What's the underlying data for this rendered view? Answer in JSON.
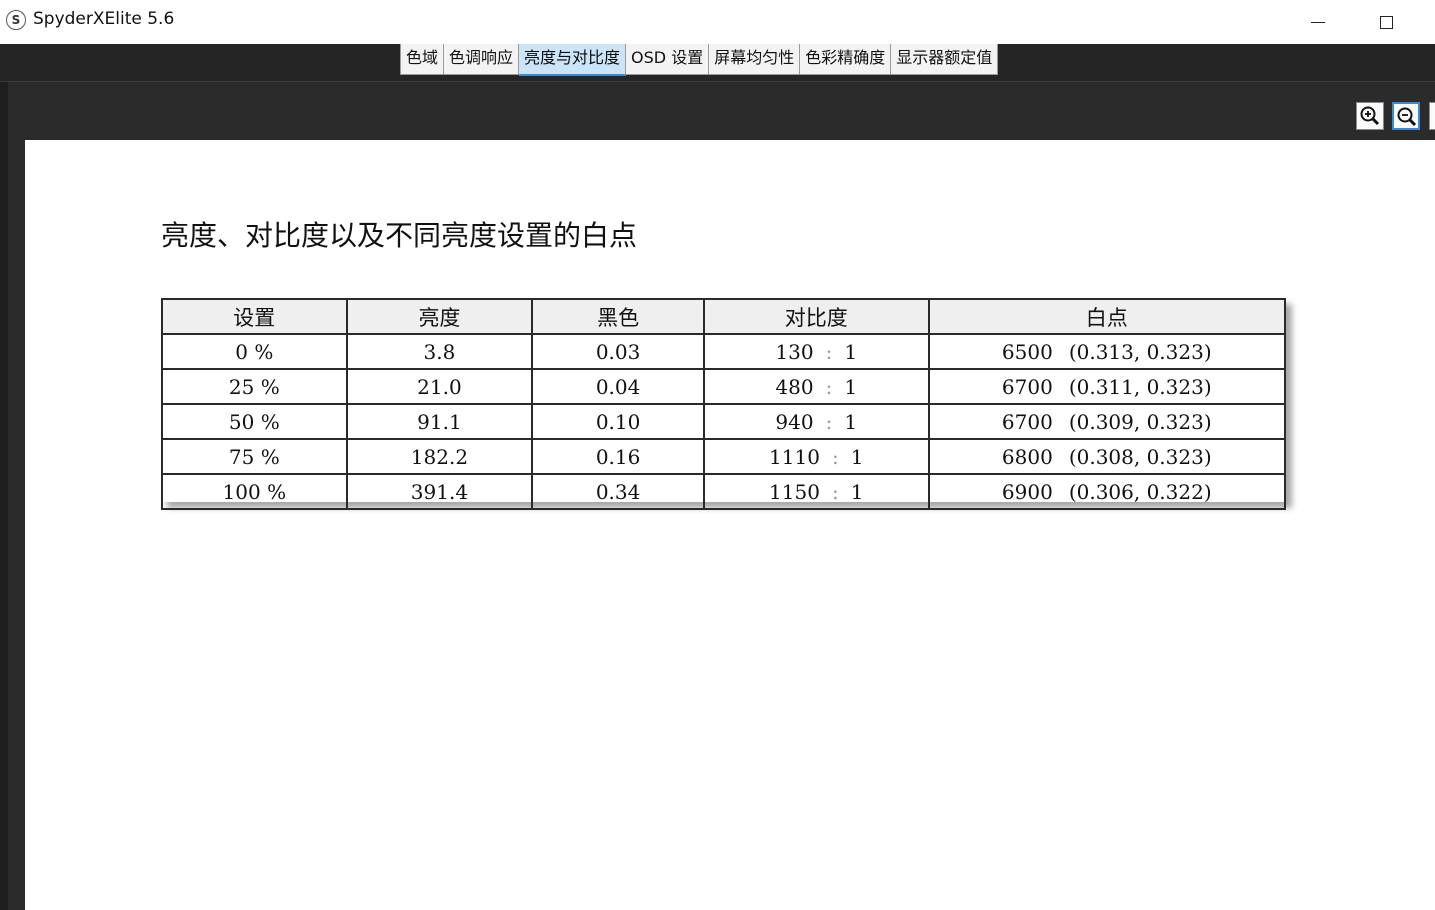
{
  "window": {
    "app_icon_letter": "S",
    "title": "SpyderXElite 5.6"
  },
  "tabs": [
    {
      "label": "色域",
      "active": false
    },
    {
      "label": "色调响应",
      "active": false
    },
    {
      "label": "亮度与对比度",
      "active": true
    },
    {
      "label": "OSD 设置",
      "active": false
    },
    {
      "label": "屏幕均匀性",
      "active": false
    },
    {
      "label": "色彩精确度",
      "active": false
    },
    {
      "label": "显示器额定值",
      "active": false
    }
  ],
  "toolbar": {
    "zoom_in_icon": "zoom-in-icon",
    "zoom_out_icon": "zoom-out-icon"
  },
  "report": {
    "title": "亮度、对比度以及不同亮度设置的白点",
    "columns": [
      "设置",
      "亮度",
      "黑色",
      "对比度",
      "白点"
    ],
    "rows": [
      {
        "setting": "0 %",
        "luminance": "3.8",
        "black": "0.03",
        "contrast": "130",
        "ratio": "1",
        "cct": "6500",
        "xy": "(0.313, 0.323)"
      },
      {
        "setting": "25 %",
        "luminance": "21.0",
        "black": "0.04",
        "contrast": "480",
        "ratio": "1",
        "cct": "6700",
        "xy": "(0.311, 0.323)"
      },
      {
        "setting": "50 %",
        "luminance": "91.1",
        "black": "0.10",
        "contrast": "940",
        "ratio": "1",
        "cct": "6700",
        "xy": "(0.309, 0.323)"
      },
      {
        "setting": "75 %",
        "luminance": "182.2",
        "black": "0.16",
        "contrast": "1110",
        "ratio": "1",
        "cct": "6800",
        "xy": "(0.308, 0.323)"
      },
      {
        "setting": "100 %",
        "luminance": "391.4",
        "black": "0.34",
        "contrast": "1150",
        "ratio": "1",
        "cct": "6900",
        "xy": "(0.306, 0.322)"
      }
    ],
    "ratio_separator": ":"
  },
  "colors": {
    "active_tab_bg": "#cce4f7",
    "active_tab_accent": "#3b8ad6",
    "workspace_bg": "#2b2b2b"
  }
}
